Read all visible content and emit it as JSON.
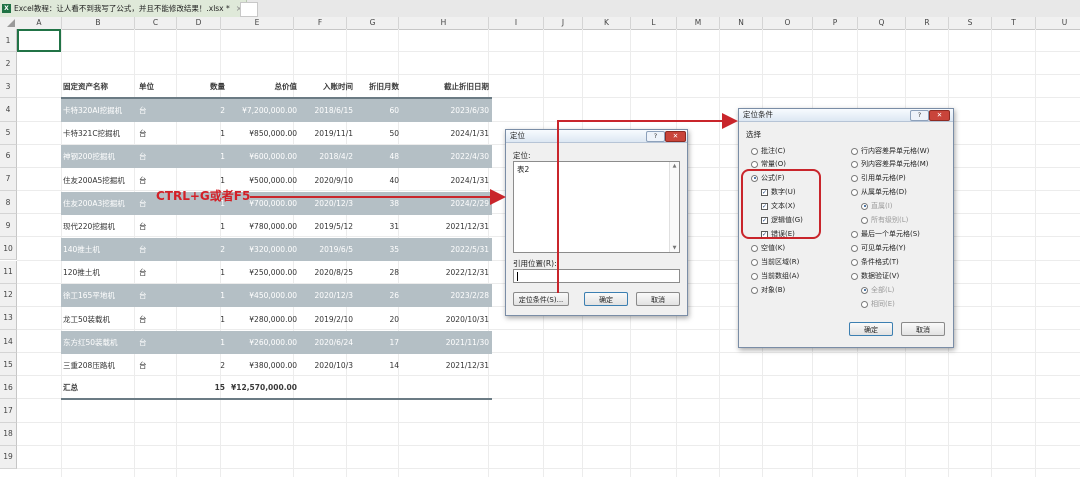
{
  "window": {
    "tab_title": "Excel教程：让人看不到我写了公式，并且不能修改结果！.xlsx *",
    "tab_close": "×",
    "app_icon": "excel-icon"
  },
  "grid": {
    "columns": [
      "A",
      "B",
      "C",
      "D",
      "E",
      "F",
      "G",
      "H",
      "I",
      "J",
      "K",
      "L",
      "M",
      "N",
      "O",
      "P",
      "Q",
      "R",
      "S",
      "T",
      "U"
    ],
    "rows": [
      "1",
      "2",
      "3",
      "4",
      "5",
      "6",
      "7",
      "8",
      "9",
      "10",
      "11",
      "12",
      "13",
      "14",
      "15",
      "16",
      "17",
      "18",
      "19"
    ]
  },
  "table": {
    "headers": [
      "固定资产名称",
      "单位",
      "数量",
      "总价值",
      "入账时间",
      "折旧月数",
      "截止折旧日期"
    ],
    "rows": [
      [
        "卡特320AI挖掘机",
        "台",
        "2",
        "¥7,200,000.00",
        "2018/6/15",
        "60",
        "2023/6/30"
      ],
      [
        "卡特321C挖掘机",
        "台",
        "1",
        "¥850,000.00",
        "2019/11/1",
        "50",
        "2024/1/31"
      ],
      [
        "神钢200挖掘机",
        "台",
        "1",
        "¥600,000.00",
        "2018/4/2",
        "48",
        "2022/4/30"
      ],
      [
        "住友200A5挖掘机",
        "台",
        "1",
        "¥500,000.00",
        "2020/9/10",
        "40",
        "2024/1/31"
      ],
      [
        "住友200A3挖掘机",
        "台",
        "1",
        "¥700,000.00",
        "2020/12/3",
        "38",
        "2024/2/29"
      ],
      [
        "现代220挖掘机",
        "台",
        "1",
        "¥780,000.00",
        "2019/5/12",
        "31",
        "2021/12/31"
      ],
      [
        "140推土机",
        "台",
        "2",
        "¥320,000.00",
        "2019/6/5",
        "35",
        "2022/5/31"
      ],
      [
        "120推土机",
        "台",
        "1",
        "¥250,000.00",
        "2020/8/25",
        "28",
        "2022/12/31"
      ],
      [
        "徐工165平地机",
        "台",
        "1",
        "¥450,000.00",
        "2020/12/3",
        "26",
        "2023/2/28"
      ],
      [
        "龙工50装载机",
        "台",
        "1",
        "¥280,000.00",
        "2019/2/10",
        "20",
        "2020/10/31"
      ],
      [
        "东方红50装载机",
        "台",
        "1",
        "¥260,000.00",
        "2020/6/24",
        "17",
        "2021/11/30"
      ],
      [
        "三重208压路机",
        "台",
        "2",
        "¥380,000.00",
        "2020/10/3",
        "14",
        "2021/12/31"
      ]
    ],
    "total": [
      "汇总",
      "",
      "15",
      "¥12,570,000.00",
      "",
      "",
      ""
    ]
  },
  "annotation": {
    "shortcut": "CTRL+G或者F5"
  },
  "goto_dialog": {
    "title": "定位",
    "help": "?",
    "close": "✕",
    "goto_label": "定位:",
    "list_items": [
      "表2"
    ],
    "reference_label": "引用位置(R):",
    "reference_value": "",
    "special_button": "定位条件(S)...",
    "ok_button": "确定",
    "cancel_button": "取消"
  },
  "special_dialog": {
    "title": "定位条件",
    "help": "?",
    "close": "✕",
    "group_label": "选择",
    "left_options": [
      {
        "label": "批注(C)",
        "type": "radio",
        "checked": false,
        "disabled": false
      },
      {
        "label": "常量(O)",
        "type": "radio",
        "checked": false,
        "disabled": false
      },
      {
        "label": "公式(F)",
        "type": "radio",
        "checked": true,
        "disabled": false
      },
      {
        "label": "数字(U)",
        "type": "check",
        "checked": true,
        "disabled": false
      },
      {
        "label": "文本(X)",
        "type": "check",
        "checked": true,
        "disabled": false
      },
      {
        "label": "逻辑值(G)",
        "type": "check",
        "checked": true,
        "disabled": false
      },
      {
        "label": "错误(E)",
        "type": "check",
        "checked": true,
        "disabled": false
      },
      {
        "label": "空值(K)",
        "type": "radio",
        "checked": false,
        "disabled": false
      },
      {
        "label": "当前区域(R)",
        "type": "radio",
        "checked": false,
        "disabled": false
      },
      {
        "label": "当前数组(A)",
        "type": "radio",
        "checked": false,
        "disabled": false
      },
      {
        "label": "对象(B)",
        "type": "radio",
        "checked": false,
        "disabled": false
      }
    ],
    "right_options": [
      {
        "label": "行内容差异单元格(W)",
        "type": "radio",
        "checked": false,
        "disabled": false
      },
      {
        "label": "列内容差异单元格(M)",
        "type": "radio",
        "checked": false,
        "disabled": false
      },
      {
        "label": "引用单元格(P)",
        "type": "radio",
        "checked": false,
        "disabled": false
      },
      {
        "label": "从属单元格(D)",
        "type": "radio",
        "checked": false,
        "disabled": false
      },
      {
        "label": "直属(I)",
        "type": "radio",
        "checked": true,
        "disabled": true
      },
      {
        "label": "所有级别(L)",
        "type": "radio",
        "checked": false,
        "disabled": true
      },
      {
        "label": "最后一个单元格(S)",
        "type": "radio",
        "checked": false,
        "disabled": false
      },
      {
        "label": "可见单元格(Y)",
        "type": "radio",
        "checked": false,
        "disabled": false
      },
      {
        "label": "条件格式(T)",
        "type": "radio",
        "checked": false,
        "disabled": false
      },
      {
        "label": "数据验证(V)",
        "type": "radio",
        "checked": false,
        "disabled": false
      },
      {
        "label": "全部(L)",
        "type": "radio",
        "checked": true,
        "disabled": true
      },
      {
        "label": "相同(E)",
        "type": "radio",
        "checked": false,
        "disabled": true
      }
    ],
    "ok_button": "确定",
    "cancel_button": "取消"
  },
  "colors": {
    "shade_row": "#b4bfc5",
    "accent_red": "#c9252b",
    "excel_green": "#217346"
  }
}
